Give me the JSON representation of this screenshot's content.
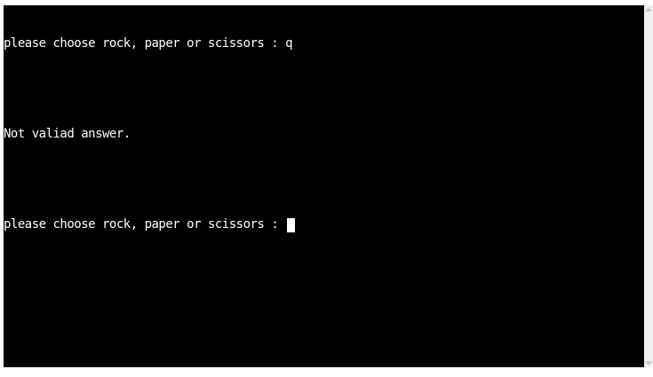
{
  "terminal": {
    "lines": [
      {
        "prompt": "please choose rock, paper or scissors : ",
        "input": "q"
      },
      {
        "text": "Not valiad answer."
      },
      {
        "prompt": "please choose rock, paper or scissors : ",
        "input": ""
      }
    ]
  },
  "colors": {
    "background": "#000000",
    "text": "#ffffff",
    "page": "#ffffff"
  },
  "icons": {
    "scroll_up": "scroll-up-arrow-icon",
    "scroll_down": "scroll-down-arrow-icon"
  }
}
